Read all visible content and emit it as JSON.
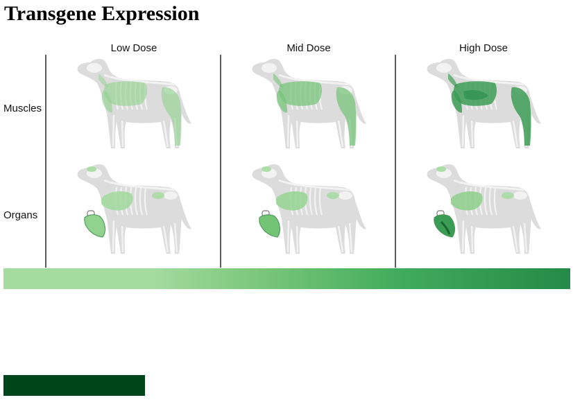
{
  "title": "Transgene Expression",
  "columns": [
    {
      "label": "Low Dose",
      "level": 0.2
    },
    {
      "label": "Mid Dose",
      "level": 0.5
    },
    {
      "label": "High Dose",
      "level": 0.85
    }
  ],
  "rows": [
    {
      "label": "Muscles"
    },
    {
      "label": "Organs"
    }
  ],
  "colors": {
    "dog_body": "#dcdcdc",
    "dog_skeleton": "#f2f2f2",
    "expression_light": "#a6dba0",
    "expression_mid": "#74c476",
    "expression_strong": "#238b45",
    "expression_dark": "#00441b",
    "divider": "#5a5a5a"
  },
  "legend": {
    "gradient_stops": [
      "#a6dba0",
      "#74c476",
      "#41ab5d",
      "#238b45"
    ],
    "dark_swatch": "#00441b"
  }
}
